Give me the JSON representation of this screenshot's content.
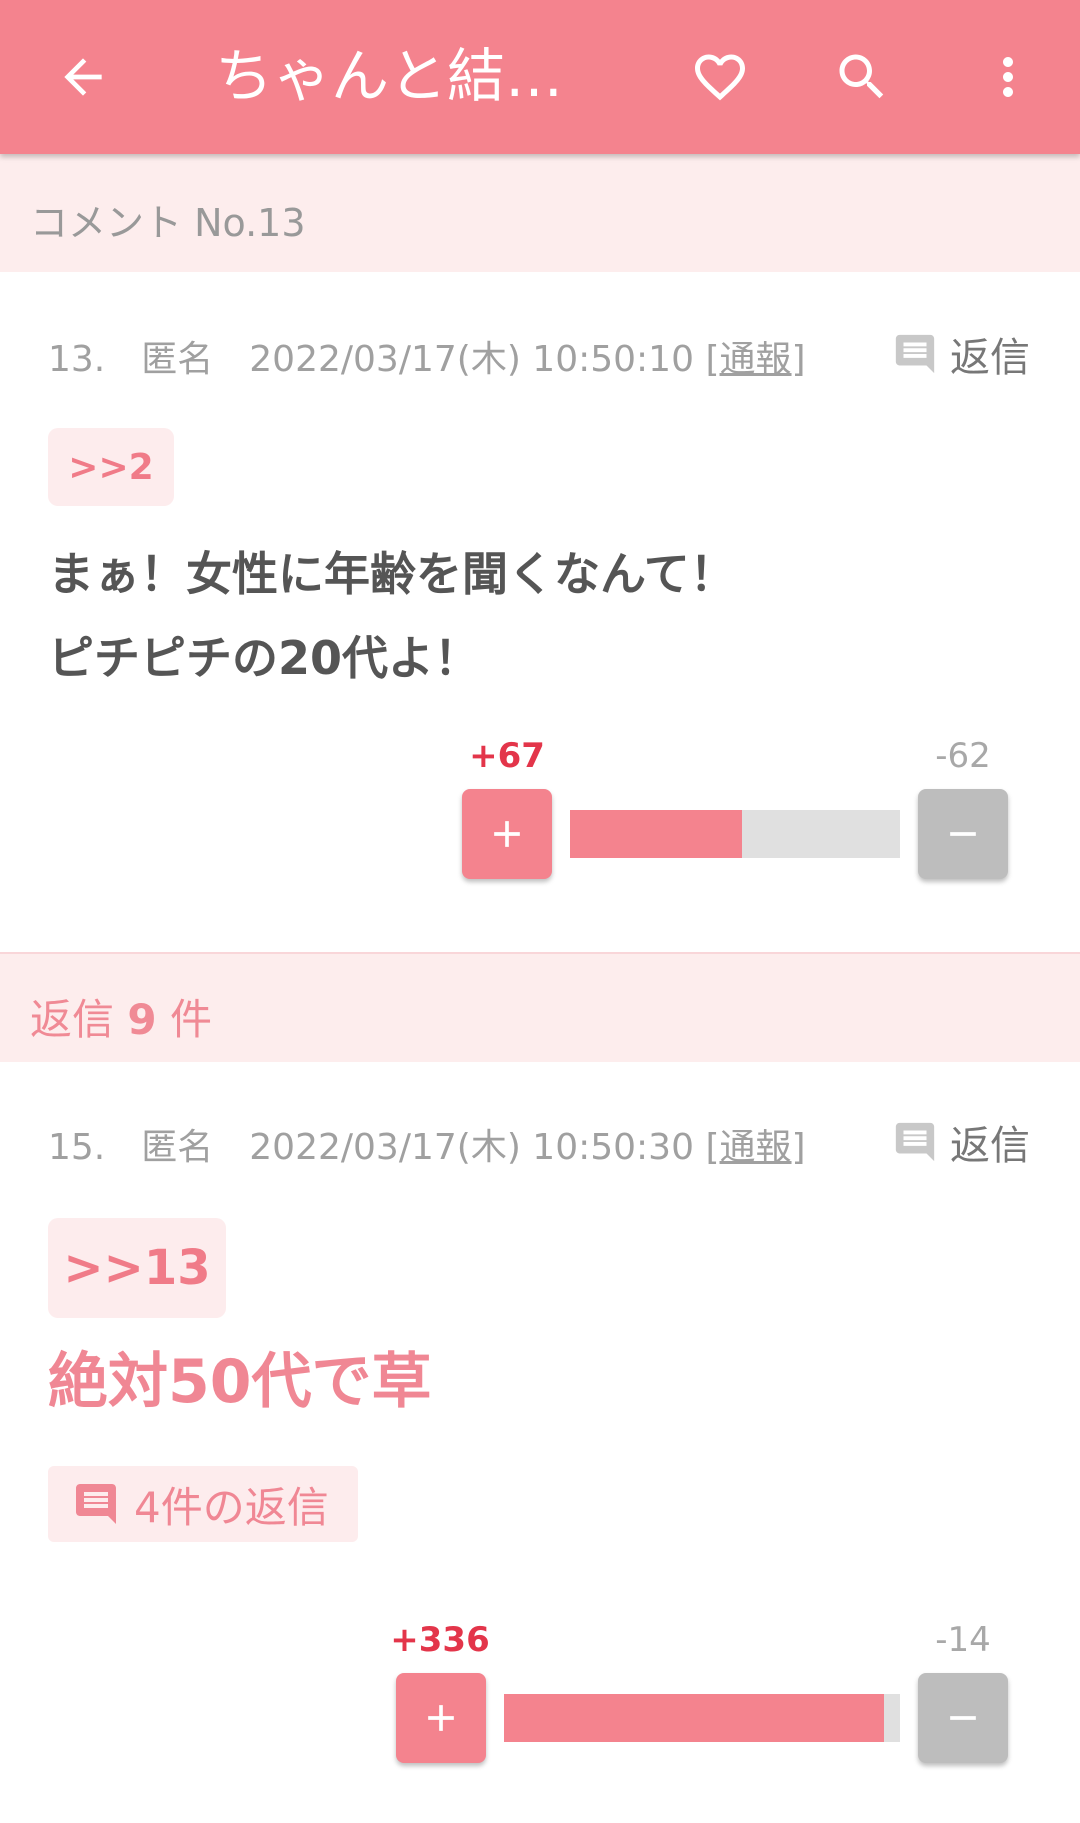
{
  "appbar": {
    "title": "ちゃんと結婚…",
    "icons": [
      "back-arrow-icon",
      "heart-icon",
      "search-icon",
      "more-vert-icon"
    ],
    "color": "#f4838e"
  },
  "breadcrumb": {
    "label": "コメント No.13"
  },
  "comment": {
    "number": "13.",
    "author": "匿名",
    "datetime": "2022/03/17(木) 10:50:10",
    "report_label": "通報",
    "reply_label": "返信",
    "anchor": ">>2",
    "lines": [
      "まぁ！女性に年齢を聞くなんて！",
      "ピチピチの20代よ！"
    ],
    "plus_count": "+67",
    "minus_count": "-62",
    "plus_ratio": 0.52
  },
  "replies_header": {
    "prefix": "返信",
    "count": "9",
    "suffix": "件"
  },
  "reply": {
    "number": "15.",
    "author": "匿名",
    "datetime": "2022/03/17(木) 10:50:30",
    "report_label": "通報",
    "reply_label": "返信",
    "anchor": ">>13",
    "text": "絶対50代で草",
    "sub_replies_label": "4件の返信",
    "plus_count": "+336",
    "minus_count": "-14",
    "plus_ratio": 0.96
  }
}
